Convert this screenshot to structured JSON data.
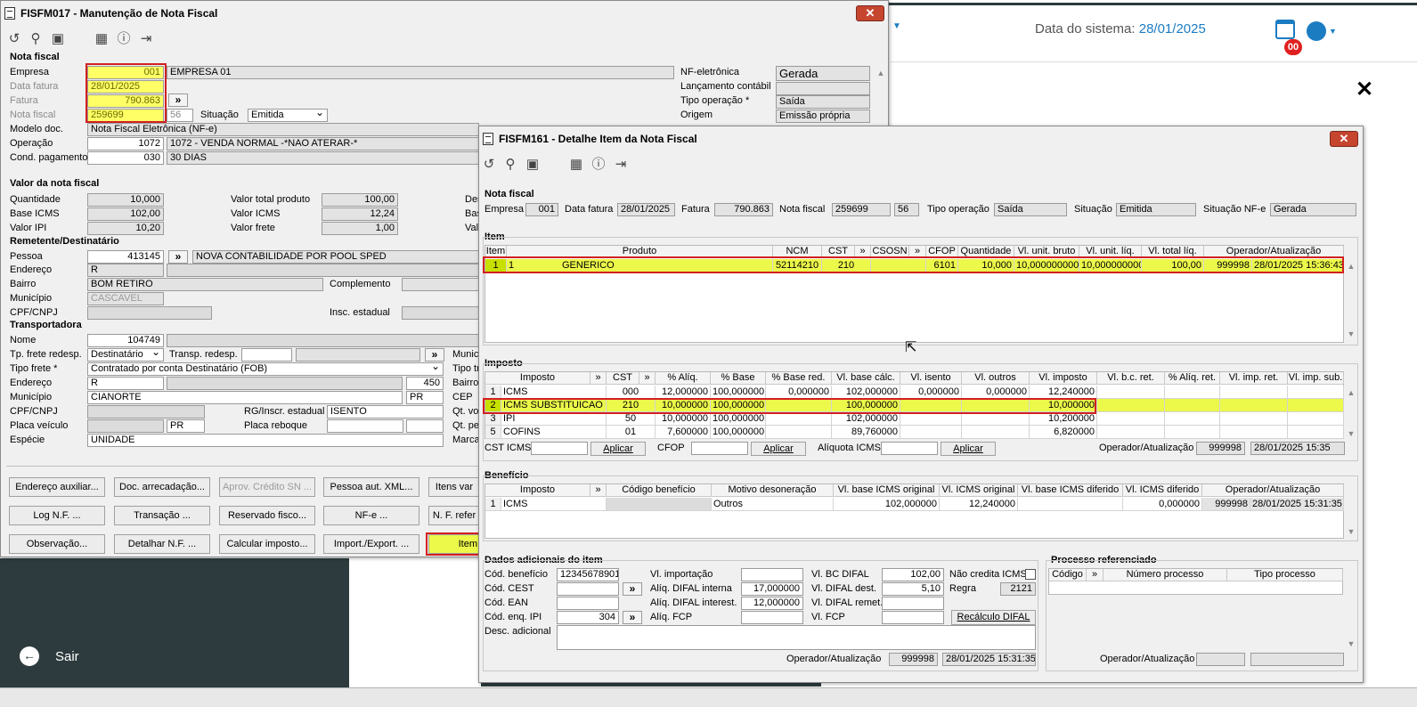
{
  "bg": {
    "sysdate_label": "Data do sistema:",
    "sysdate_value": "28/01/2025",
    "badge": "00",
    "close": "✕",
    "sair": "Sair"
  },
  "w1": {
    "title": "FISFM017 - Manutenção de Nota Fiscal",
    "nota": {
      "section": "Nota fiscal",
      "empresa_l": "Empresa",
      "empresa": "001",
      "empresa_nome": "EMPRESA 01",
      "data_l": "Data fatura",
      "data": "28/01/2025",
      "fatura_l": "Fatura",
      "fatura": "790.863",
      "nf_l": "Nota fiscal",
      "nf": "259699",
      "serie": "56",
      "situacao_l": "Situação",
      "situacao": "Emitida",
      "modelo_l": "Modelo doc.",
      "modelo": "Nota Fiscal Eletrônica (NF-e)",
      "oper_l": "Operação",
      "oper": "1072",
      "oper_desc": "1072 - VENDA NORMAL -*NAO ATERAR-*",
      "cond_l": "Cond. pagamento",
      "cond": "030",
      "cond_desc": "30 DIAS",
      "nfe_l": "NF-eletrônica",
      "nfe": "Gerada",
      "lanc_l": "Lançamento contábil",
      "tipo_l": "Tipo operação *",
      "tipo": "Saída",
      "origem_l": "Origem",
      "origem": "Emissão própria"
    },
    "valor": {
      "section": "Valor da nota fiscal",
      "qtd_l": "Quantidade",
      "qtd": "10,000",
      "base_l": "Base ICMS",
      "base": "102,00",
      "ipi_l": "Valor IPI",
      "ipi": "10,20",
      "vtp_l": "Valor total produto",
      "vtp": "100,00",
      "vicms_l": "Valor ICMS",
      "vicms": "12,24",
      "vfrete_l": "Valor frete",
      "vfrete": "1,00",
      "c1": "Des",
      "c2": "Bas",
      "c3": "Val"
    },
    "rem": {
      "section": "Remetente/Destinatário",
      "pessoa_l": "Pessoa",
      "pessoa": "413145",
      "pessoa_nome": "NOVA CONTABILIDADE POR POOL SPED",
      "end_l": "Endereço",
      "end": "R",
      "bairro_l": "Bairro",
      "bairro": "BOM RETIRO",
      "compl_l": "Complemento",
      "mun_l": "Município",
      "mun": "CASCAVEL",
      "cpf_l": "CPF/CNPJ",
      "insc_l": "Insc. estadual"
    },
    "transp": {
      "section": "Transportadora",
      "nome_l": "Nome",
      "nome": "104749",
      "tpf_l": "Tp. frete redesp.",
      "tpf": "Destinatário",
      "tr_l": "Transp. redesp.",
      "tipof_l": "Tipo frete *",
      "tipof": "Contratado por conta Destinatário (FOB)",
      "end_l": "Endereço",
      "end": "R",
      "num": "450",
      "mun_l": "Município",
      "mun": "CIANORTE",
      "uf": "PR",
      "cpf_l": "CPF/CNPJ",
      "rg_l": "RG/Inscr. estadual",
      "rg": "ISENTO",
      "placa_l": "Placa veículo",
      "placa_uf": "PR",
      "reb_l": "Placa reboque",
      "esp_l": "Espécie",
      "esp": "UNIDADE",
      "r1": "Munic",
      "r2": "Tipo tr",
      "r3": "Bairro",
      "r4": "CEP",
      "r5": "Qt. vo",
      "r6": "Qt. pe",
      "r7": "Marca"
    },
    "btns": [
      "Endereço auxiliar...",
      "Doc. arrecadação...",
      "Aprov. Crédito SN ...",
      "Pessoa aut. XML...",
      "Itens var",
      "Log N.F. ...",
      "Transação ...",
      "Reservado fisco...",
      "NF-e ...",
      "N. F. refer",
      "Observação...",
      "Detalhar N.F. ...",
      "Calcular imposto...",
      "Import./Export. ...",
      "Item"
    ]
  },
  "w2": {
    "title": "FISFM161 - Detalhe Item da Nota Fiscal",
    "nf": {
      "section": "Nota fiscal",
      "empresa_l": "Empresa",
      "empresa": "001",
      "data_l": "Data fatura",
      "data": "28/01/2025",
      "fatura_l": "Fatura",
      "fatura": "790.863",
      "nf_l": "Nota fiscal",
      "nf": "259699",
      "serie": "56",
      "tipo_l": "Tipo operação",
      "tipo": "Saída",
      "sit_l": "Situação",
      "sit": "Emitida",
      "sitnfe_l": "Situação NF-e",
      "sitnfe": "Gerada"
    },
    "item": {
      "section": "Item",
      "headers": [
        "Item",
        "Produto",
        "NCM",
        "CST",
        "»",
        "CSOSN",
        "»",
        "CFOP",
        "Quantidade",
        "Vl. unit. bruto",
        "Vl. unit. líq.",
        "Vl. total líq.",
        "Operador/Atualização"
      ],
      "row": [
        "1",
        "1",
        "GENERICO",
        "52114210",
        "210",
        "",
        "",
        "6101",
        "10,000",
        "10,0000000000",
        "10,000000000",
        "100,00",
        "999998",
        "28/01/2025 15:36:43"
      ]
    },
    "imposto": {
      "section": "Imposto",
      "headers": [
        "Imposto",
        "»",
        "CST",
        "»",
        "% Alíq.",
        "% Base",
        "% Base red.",
        "Vl. base cálc.",
        "Vl. isento",
        "Vl. outros",
        "Vl. imposto",
        "Vl. b.c. ret.",
        "% Alíq. ret.",
        "Vl. imp. ret.",
        "Vl. imp. sub."
      ],
      "rows": [
        [
          "1",
          "ICMS",
          "000",
          "12,000000",
          "100,000000",
          "0,000000",
          "102,000000",
          "0,000000",
          "0,000000",
          "12,240000"
        ],
        [
          "2",
          "ICMS SUBSTITUICAO TR",
          "210",
          "10,000000",
          "100,000000",
          "",
          "100,000000",
          "",
          "",
          "10,000000"
        ],
        [
          "3",
          "IPI",
          "50",
          "10,000000",
          "100,000000",
          "",
          "102,000000",
          "",
          "",
          "10,200000"
        ],
        [
          "5",
          "COFINS",
          "01",
          "7,600000",
          "100,000000",
          "",
          "89,760000",
          "",
          "",
          "6,820000"
        ]
      ],
      "cst_l": "CST ICMS",
      "aplicar": "Aplicar",
      "cfop_l": "CFOP",
      "aliq_l": "Alíquota ICMS",
      "op_l": "Operador/Atualização",
      "op": "999998",
      "op_dt": "28/01/2025 15:35"
    },
    "benef": {
      "section": "Benefício",
      "headers": [
        "Imposto",
        "»",
        "Código benefício",
        "Motivo desoneração",
        "Vl. base ICMS original",
        "Vl. ICMS original",
        "Vl. base ICMS diferido",
        "Vl. ICMS diferido",
        "Operador/Atualização"
      ],
      "row": [
        "1",
        "ICMS",
        "",
        "Outros",
        "102,000000",
        "12,240000",
        "",
        "0,000000",
        "999998",
        "28/01/2025 15:31:35"
      ]
    },
    "dados": {
      "section": "Dados adicionais do item",
      "cb_l": "Cód. benefício",
      "cb": "12345678901",
      "cest_l": "Cód. CEST",
      "ean_l": "Cód. EAN",
      "enq_l": "Cód. enq. IPI",
      "enq": "304",
      "imp_l": "Vl. importação",
      "adi_l": "Alíq. DIFAL interna",
      "adi": "17,000000",
      "ade_l": "Alíq. DIFAL interest.",
      "ade": "12,000000",
      "afcp_l": "Alíq. FCP",
      "bcd_l": "Vl. BC DIFAL",
      "bcd": "102,00",
      "vdd_l": "Vl. DIFAL dest.",
      "vdd": "5,10",
      "vdr_l": "Vl. DIFAL remet.",
      "vfcp_l": "Vl. FCP",
      "ncred_l": "Não credita ICMS",
      "regra_l": "Regra",
      "regra": "2121",
      "recalc": "Recálculo DIFAL",
      "desc_l": "Desc. adicional",
      "op_l": "Operador/Atualização",
      "op": "999998",
      "op_dt": "28/01/2025 15:31:35"
    },
    "proc": {
      "section": "Processo referenciado",
      "headers": [
        "Código",
        "»",
        "Número processo",
        "Tipo processo"
      ],
      "op_l": "Operador/Atualização"
    }
  }
}
